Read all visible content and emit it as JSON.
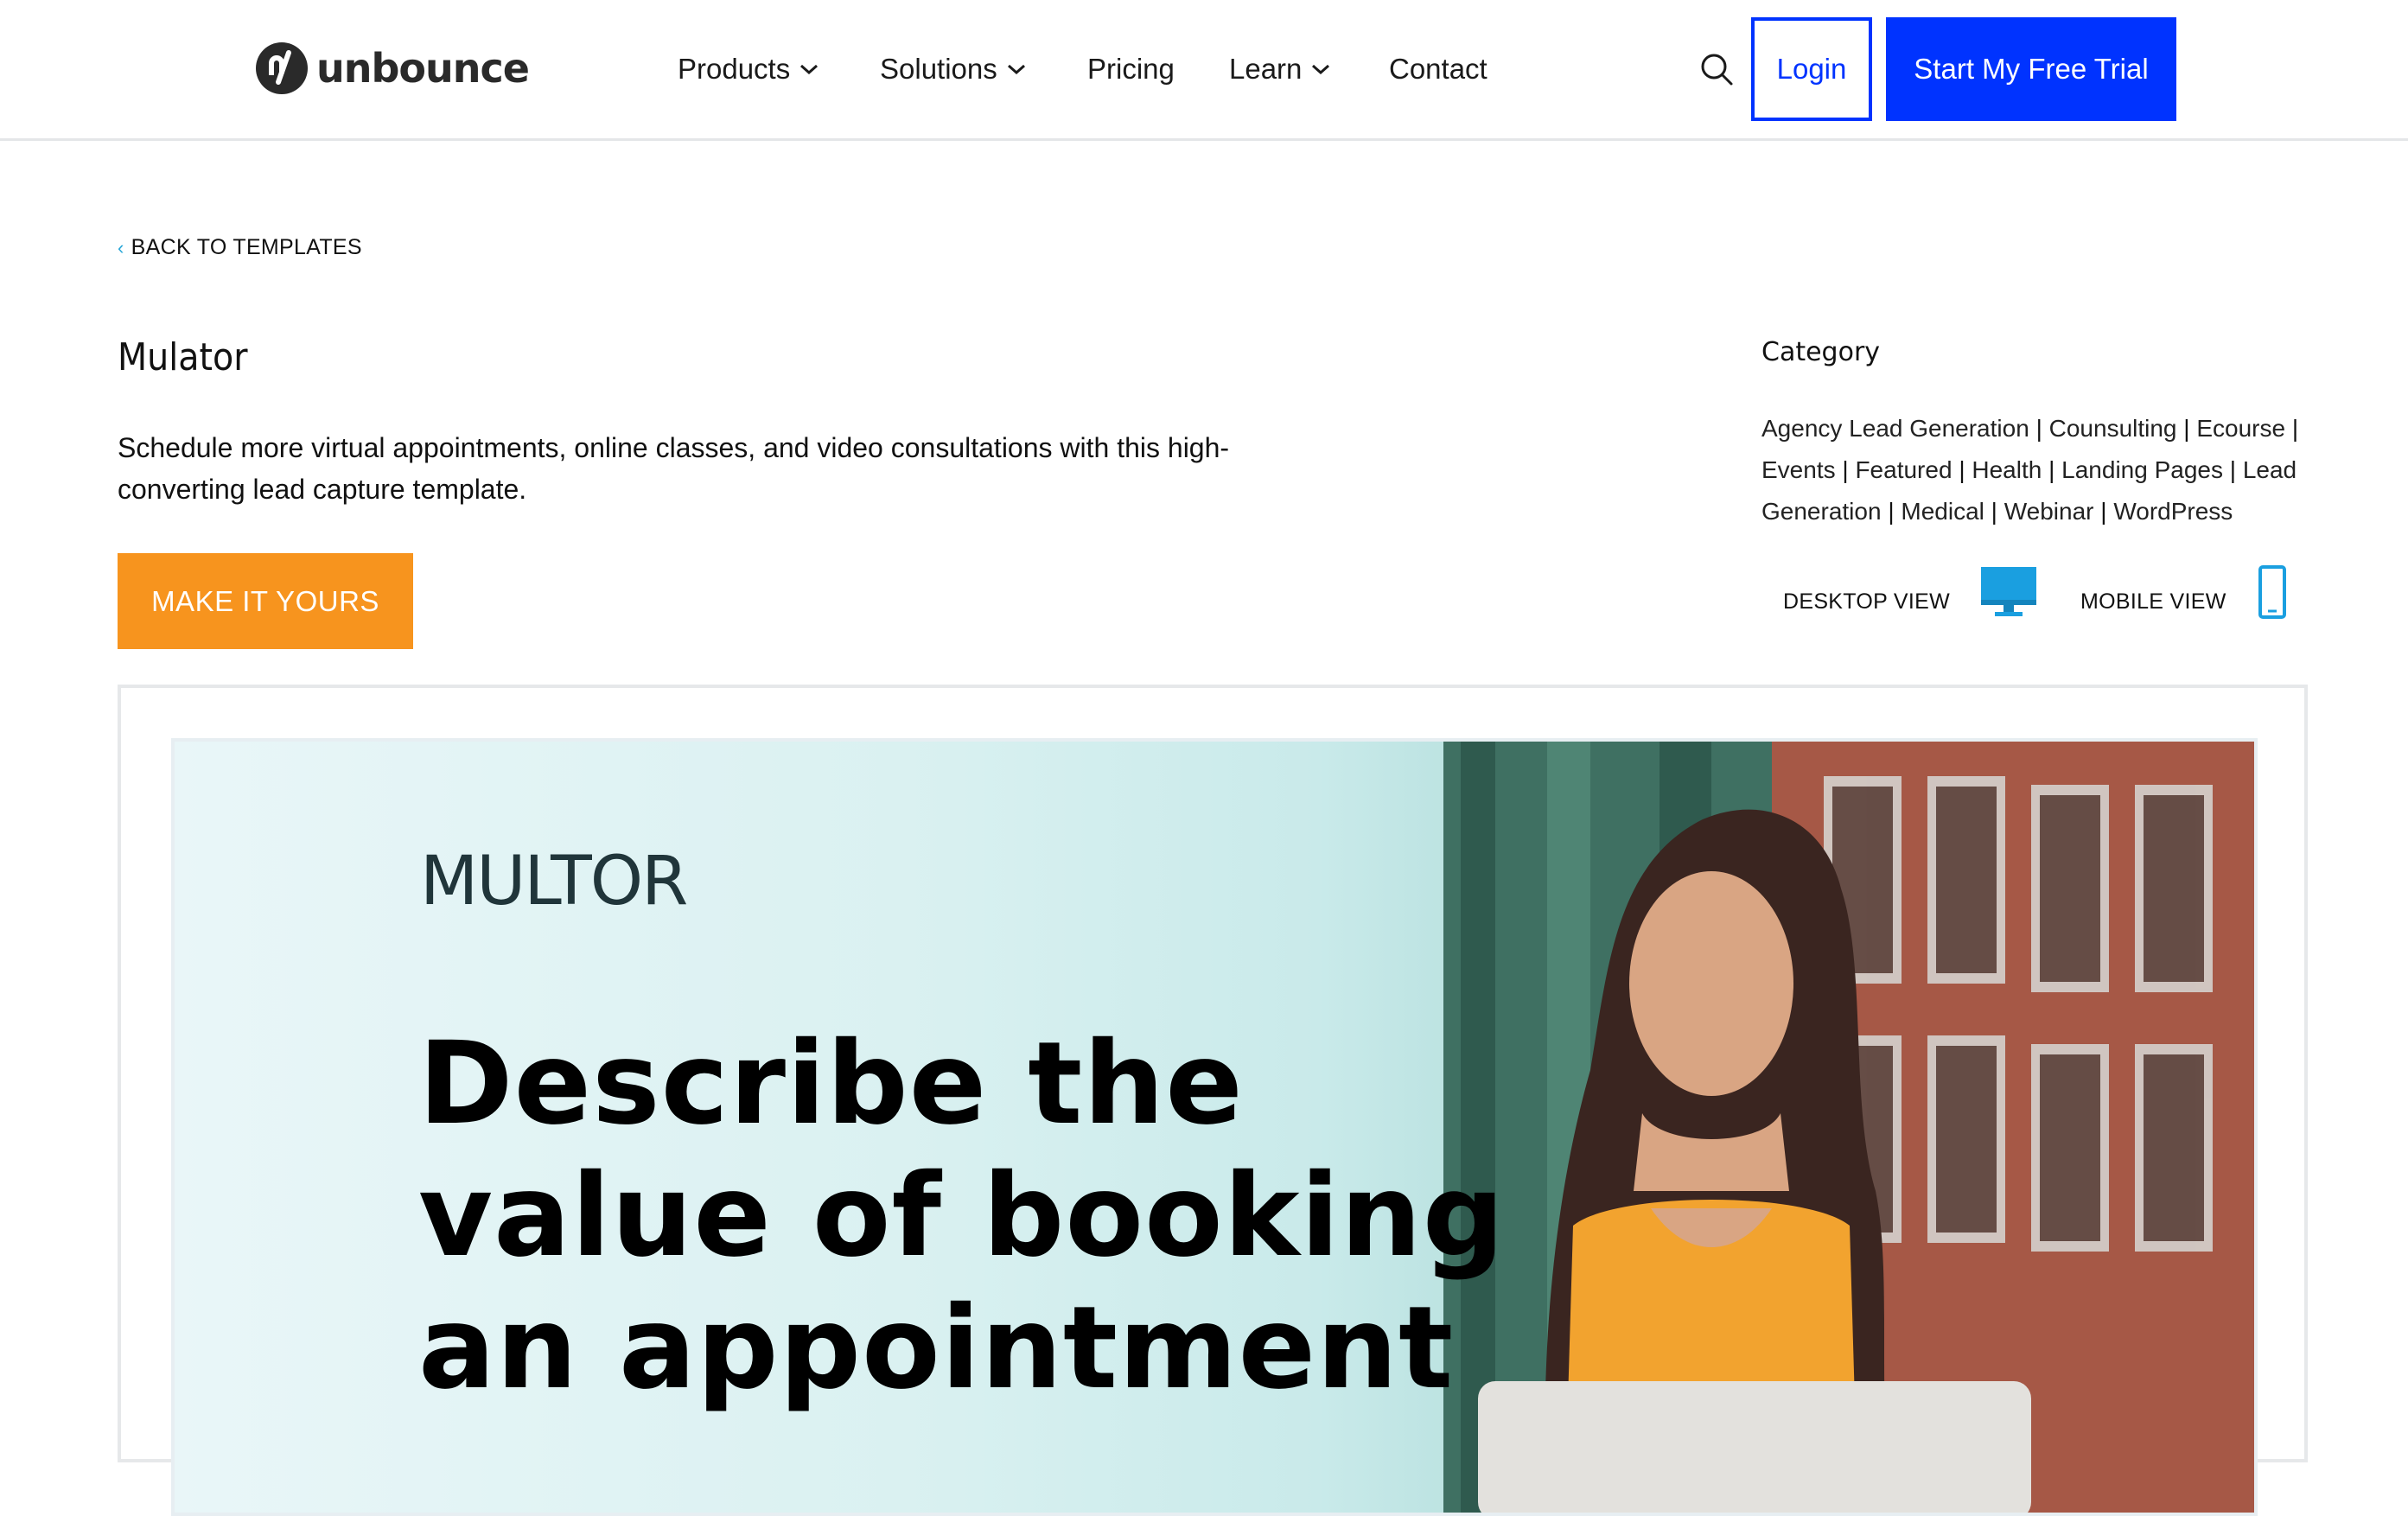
{
  "header": {
    "brand": "unbounce",
    "nav": [
      {
        "label": "Products",
        "has_dropdown": true
      },
      {
        "label": "Solutions",
        "has_dropdown": true
      },
      {
        "label": "Pricing",
        "has_dropdown": false
      },
      {
        "label": "Learn",
        "has_dropdown": true
      },
      {
        "label": "Contact",
        "has_dropdown": false
      }
    ],
    "search_icon": "search-icon",
    "login_label": "Login",
    "trial_label": "Start My Free Trial"
  },
  "breadcrumb": {
    "back_label": "BACK TO TEMPLATES"
  },
  "template": {
    "title": "Mulator",
    "description": "Schedule more virtual appointments, online classes, and video consultations with this high-converting lead capture template.",
    "cta_label": "MAKE IT YOURS"
  },
  "category": {
    "label": "Category",
    "items": [
      "Agency Lead Generation",
      "Counsulting",
      "Ecourse",
      "Events",
      "Featured",
      "Health",
      "Landing Pages",
      "Lead Generation",
      "Medical",
      "Webinar",
      "WordPress"
    ],
    "separator": "|"
  },
  "views": {
    "desktop_label": "DESKTOP VIEW",
    "mobile_label": "MOBILE VIEW",
    "desktop_icon": "monitor-icon",
    "mobile_icon": "phone-icon"
  },
  "preview": {
    "logo_text": "MULTOR",
    "headline_lines": [
      "Describe the",
      "value of booking",
      "an appointment"
    ]
  },
  "colors": {
    "primary_blue": "#0033ff",
    "cta_orange": "#f7941e",
    "view_icon_blue": "#1a9fe0"
  }
}
